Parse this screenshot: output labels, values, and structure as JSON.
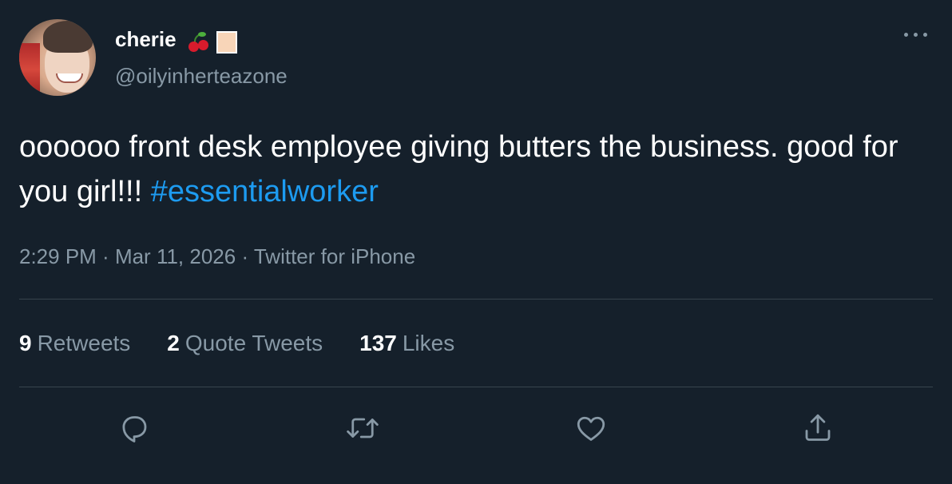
{
  "author": {
    "display_name": "cherie",
    "name_emojis": [
      "cherry-icon",
      "square-emoji-icon"
    ],
    "handle": "@oilyinherteazone",
    "avatar": "profile-photo"
  },
  "more_icon": "more-horizontal-icon",
  "tweet": {
    "text": "oooooo front desk employee giving butters the business. good for you girl!!! ",
    "hashtag": "#essentialworker"
  },
  "meta": {
    "time": "2:29 PM",
    "date": "Mar 11, 2026",
    "source": "Twitter for iPhone",
    "separator": " · "
  },
  "stats": {
    "retweets": {
      "count": "9",
      "label": "Retweets"
    },
    "quote_tweets": {
      "count": "2",
      "label": "Quote Tweets"
    },
    "likes": {
      "count": "137",
      "label": "Likes"
    }
  },
  "actions": [
    {
      "name": "reply",
      "icon": "reply-icon"
    },
    {
      "name": "retweet",
      "icon": "retweet-icon"
    },
    {
      "name": "like",
      "icon": "heart-icon"
    },
    {
      "name": "share",
      "icon": "share-icon"
    }
  ],
  "colors": {
    "background": "#15202b",
    "text": "#ffffff",
    "secondary": "#8899a6",
    "accent": "#1d9bf0",
    "divider": "#38444d"
  }
}
